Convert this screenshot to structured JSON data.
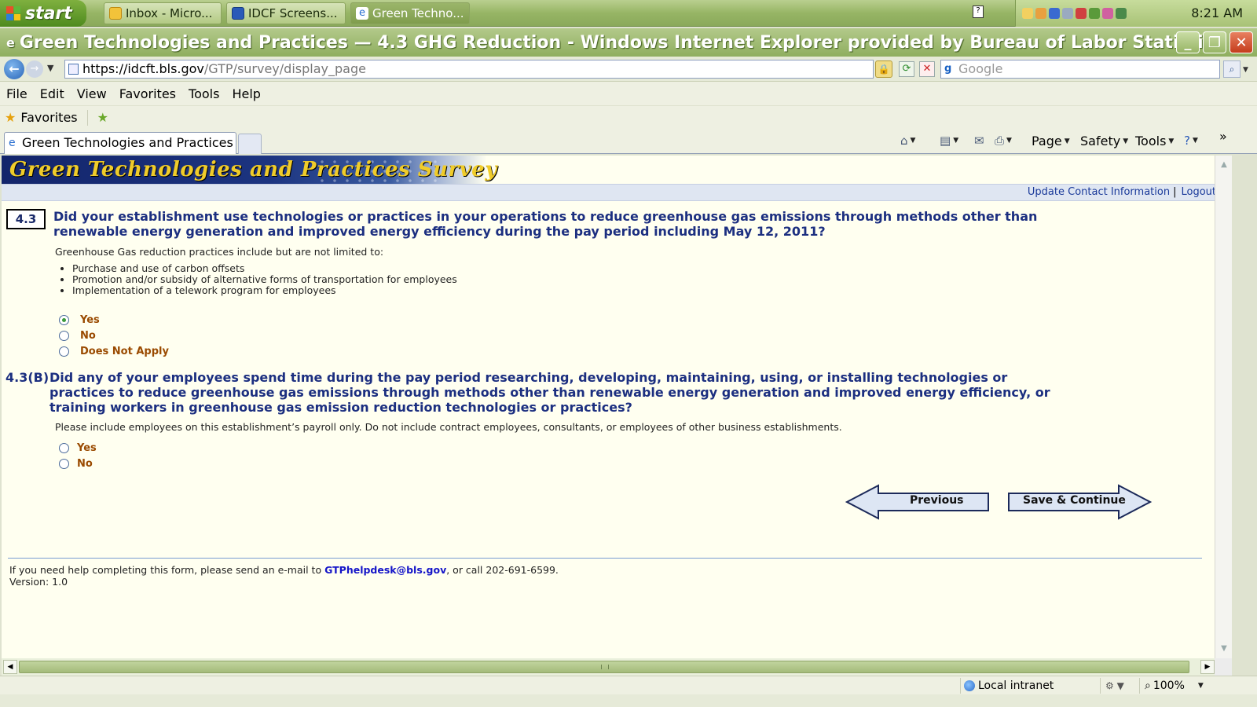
{
  "taskbar": {
    "start_label": "start",
    "tasks": [
      {
        "label": "Inbox - Micro...",
        "icon": "outlook-icon"
      },
      {
        "label": "IDCF Screens...",
        "icon": "word-icon"
      },
      {
        "label": "Green Techno...",
        "icon": "ie-icon",
        "active": true
      }
    ],
    "clock": "8:21 AM"
  },
  "window": {
    "title": "Green Technologies and Practices — 4.3 GHG Reduction - Windows Internet Explorer provided by Bureau of Labor Statistics"
  },
  "address": {
    "url_host": "https://idcft.bls.gov",
    "url_path": "/GTP/survey/display_page",
    "search_placeholder": "Google"
  },
  "menu": [
    "File",
    "Edit",
    "View",
    "Favorites",
    "Tools",
    "Help"
  ],
  "favorites": {
    "label": "Favorites"
  },
  "tab": {
    "label": "Green Technologies and Practices ..."
  },
  "commandbar": {
    "page": "Page",
    "safety": "Safety",
    "tools": "Tools"
  },
  "page": {
    "banner_title": "Green Technologies and Practices Survey",
    "links": {
      "update_contact": "Update Contact Information",
      "separator": "|",
      "logout": "Logout"
    },
    "q1": {
      "number": "4.3",
      "text": "Did your establishment use technologies or practices in your operations to reduce greenhouse gas emissions through methods other than renewable energy generation and improved energy efficiency during the pay period including May 12, 2011?",
      "note": "Greenhouse Gas reduction practices include but are not limited to:",
      "bullets": [
        "Purchase and use of carbon offsets",
        "Promotion and/or subsidy of alternative forms of transportation for employees",
        "Implementation of a telework program for employees"
      ],
      "options": [
        {
          "label": "Yes",
          "checked": true
        },
        {
          "label": "No",
          "checked": false
        },
        {
          "label": "Does Not Apply",
          "checked": false
        }
      ]
    },
    "q2": {
      "number": "4.3(B)",
      "text": "Did any of your employees spend time during the pay period researching, developing, maintaining, using, or installing technologies or practices to reduce greenhouse gas emissions through methods other than renewable energy generation and improved energy efficiency, or training workers in greenhouse gas emission reduction technologies or practices?",
      "note": "Please include employees on this establishment’s payroll only. Do not include contract employees, consultants, or employees of other business establishments.",
      "options": [
        {
          "label": "Yes",
          "checked": false
        },
        {
          "label": "No",
          "checked": false
        }
      ]
    },
    "buttons": {
      "previous": "Previous",
      "save_continue": "Save & Continue"
    },
    "footer": {
      "help_prefix": "If you need help completing this form, please send an e-mail to ",
      "help_email": "GTPhelpdesk@bls.gov",
      "help_suffix": ", or call 202-691-6599.",
      "version": "Version: 1.0"
    }
  },
  "status": {
    "zone": "Local intranet",
    "zoom": "100%"
  }
}
